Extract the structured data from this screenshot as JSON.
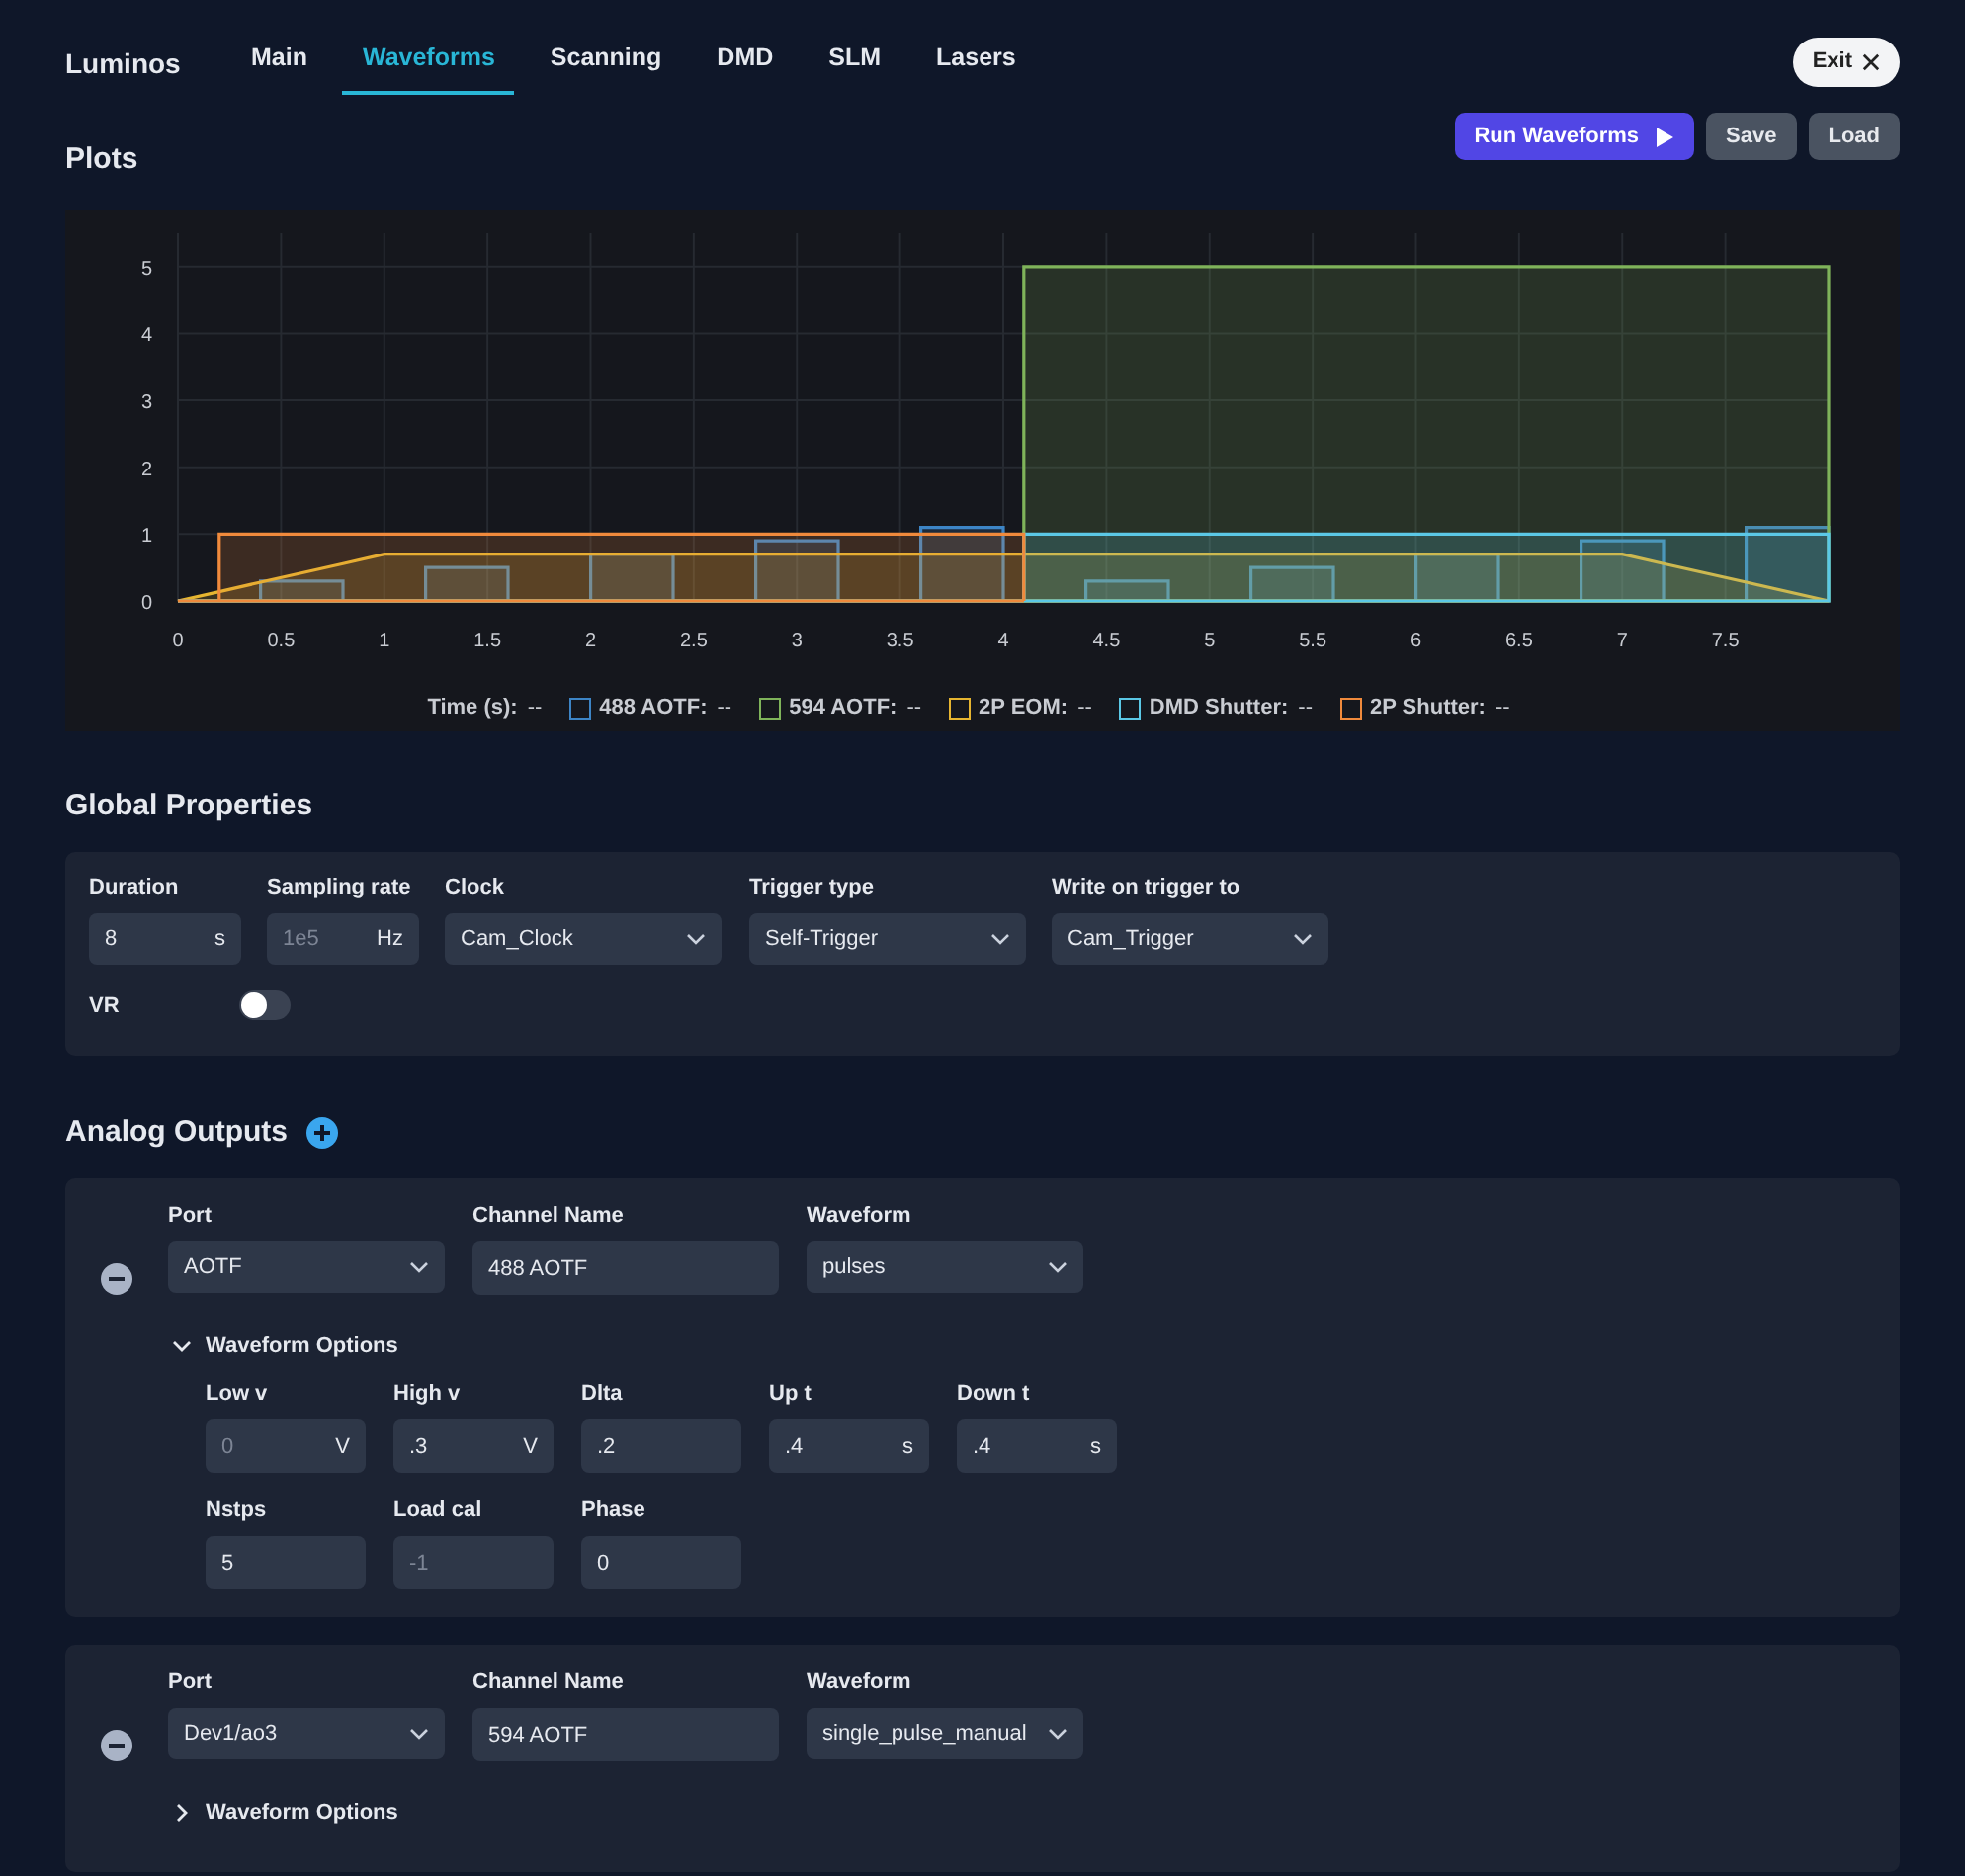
{
  "app": {
    "title": "Luminos"
  },
  "tabs": [
    {
      "label": "Main",
      "selected": false
    },
    {
      "label": "Waveforms",
      "selected": true
    },
    {
      "label": "Scanning",
      "selected": false
    },
    {
      "label": "DMD",
      "selected": false
    },
    {
      "label": "SLM",
      "selected": false
    },
    {
      "label": "Lasers",
      "selected": false
    }
  ],
  "exit_button": {
    "label": "Exit"
  },
  "plots": {
    "title": "Plots",
    "actions": [
      {
        "label": "Run Waveforms",
        "kind": "primary"
      },
      {
        "label": "Save",
        "kind": "secondary"
      },
      {
        "label": "Load",
        "kind": "secondary"
      }
    ],
    "chart_data": {
      "type": "area",
      "grid": true,
      "xlim": [
        0,
        8
      ],
      "ylim": [
        0,
        5.5
      ],
      "xticks": [
        0,
        0.5,
        1,
        1.5,
        2,
        2.5,
        3,
        3.5,
        4,
        4.5,
        5,
        5.5,
        6,
        6.5,
        7,
        7.5
      ],
      "yticks": [
        0,
        1,
        2,
        3,
        4,
        5
      ],
      "x": [
        0,
        0.2,
        0.2,
        0.4,
        0.4,
        0.8,
        0.8,
        1,
        1.2,
        1.2,
        1.6,
        1.6,
        2,
        2,
        2.4,
        2.4,
        2.8,
        2.8,
        3.2,
        3.2,
        3.6,
        3.6,
        4,
        4,
        4.1,
        4.1,
        4.4,
        4.4,
        4.8,
        4.8,
        5.2,
        5.2,
        5.6,
        5.6,
        6,
        6,
        6.4,
        6.4,
        6.8,
        6.8,
        7,
        7.2,
        7.2,
        7.6,
        7.6,
        8,
        8
      ],
      "series": [
        {
          "name": "488 AOTF",
          "color": "#3d85c6",
          "values": [
            0,
            0,
            0,
            0,
            0.3,
            0.3,
            0,
            0,
            0,
            0.5,
            0.5,
            0,
            0,
            0.7,
            0.7,
            0,
            0,
            0.9,
            0.9,
            0,
            0,
            1.1,
            1.1,
            0,
            0,
            0,
            0,
            0.3,
            0.3,
            0,
            0,
            0.5,
            0.5,
            0,
            0,
            0.7,
            0.7,
            0,
            0,
            0.9,
            0.9,
            0.9,
            0,
            0,
            1.1,
            1.1,
            0
          ]
        },
        {
          "name": "594 AOTF",
          "color": "#7fb35a",
          "values": [
            0,
            0,
            0,
            0,
            0,
            0,
            0,
            0,
            0,
            0,
            0,
            0,
            0,
            0,
            0,
            0,
            0,
            0,
            0,
            0,
            0,
            0,
            0,
            0,
            0,
            5,
            5,
            5,
            5,
            5,
            5,
            5,
            5,
            5,
            5,
            5,
            5,
            5,
            5,
            5,
            5,
            5,
            5,
            5,
            5,
            5,
            5
          ]
        },
        {
          "name": "2P EOM",
          "color": "#e6b530",
          "values": [
            0,
            0.14,
            0.14,
            0.28,
            0.28,
            0.56,
            0.56,
            0.7,
            0.7,
            0.7,
            0.7,
            0.7,
            0.7,
            0.7,
            0.7,
            0.7,
            0.7,
            0.7,
            0.7,
            0.7,
            0.7,
            0.7,
            0.7,
            0.7,
            0.7,
            0.7,
            0.7,
            0.7,
            0.7,
            0.7,
            0.7,
            0.7,
            0.7,
            0.7,
            0.7,
            0.7,
            0.7,
            0.7,
            0.7,
            0.7,
            0.7,
            0.56,
            0.56,
            0.28,
            0.28,
            0,
            0
          ]
        },
        {
          "name": "DMD Shutter",
          "color": "#5bc8e6",
          "values": [
            0,
            0,
            0,
            0,
            0,
            0,
            0,
            0,
            0,
            0,
            0,
            0,
            0,
            0,
            0,
            0,
            0,
            0,
            0,
            0,
            0,
            0,
            0,
            0,
            0,
            1,
            1,
            1,
            1,
            1,
            1,
            1,
            1,
            1,
            1,
            1,
            1,
            1,
            1,
            1,
            1,
            1,
            1,
            1,
            1,
            1,
            0
          ]
        },
        {
          "name": "2P Shutter",
          "color": "#f08a3c",
          "values": [
            0,
            0,
            1,
            1,
            1,
            1,
            1,
            1,
            1,
            1,
            1,
            1,
            1,
            1,
            1,
            1,
            1,
            1,
            1,
            1,
            1,
            1,
            1,
            1,
            1,
            0,
            null,
            null,
            null,
            null,
            null,
            null,
            null,
            null,
            null,
            null,
            null,
            null,
            null,
            null,
            null,
            null,
            null,
            null,
            null,
            null,
            null
          ]
        }
      ]
    },
    "legend": {
      "time_label": "Time (s):",
      "time_value": "--",
      "separator": ":",
      "readings": [
        "--",
        "--",
        "--",
        "--",
        "--"
      ]
    }
  },
  "global_properties": {
    "title": "Global Properties",
    "fields": [
      {
        "label": "Duration",
        "kind": "number",
        "value": "8",
        "unit": "s"
      },
      {
        "label": "Sampling rate",
        "kind": "number",
        "placeholder": "1e5",
        "unit": "Hz"
      },
      {
        "label": "Clock",
        "kind": "select",
        "value": "Cam_Clock"
      },
      {
        "label": "Trigger type",
        "kind": "select",
        "value": "Self-Trigger"
      },
      {
        "label": "Write on trigger to",
        "kind": "select",
        "value": "Cam_Trigger"
      }
    ],
    "toggle": {
      "label": "VR",
      "on": false
    }
  },
  "analog_outputs": {
    "title": "Analog Outputs",
    "channels": [
      {
        "port": {
          "label": "Port",
          "value": "AOTF"
        },
        "channel_name": {
          "label": "Channel Name",
          "value": "488 AOTF"
        },
        "waveform": {
          "label": "Waveform",
          "value": "pulses"
        },
        "options": {
          "label": "Waveform Options",
          "expanded": true,
          "fields": [
            {
              "label": "Low v",
              "placeholder": "0",
              "unit": "V"
            },
            {
              "label": "High v",
              "value": ".3",
              "unit": "V"
            },
            {
              "label": "Dlta",
              "value": ".2"
            },
            {
              "label": "Up t",
              "value": ".4",
              "unit": "s"
            },
            {
              "label": "Down t",
              "value": ".4",
              "unit": "s"
            },
            {
              "label": "Nstps",
              "value": "5"
            },
            {
              "label": "Load cal",
              "placeholder": "-1"
            },
            {
              "label": "Phase",
              "value": "0"
            }
          ]
        }
      },
      {
        "port": {
          "label": "Port",
          "value": "Dev1/ao3"
        },
        "channel_name": {
          "label": "Channel Name",
          "value": "594 AOTF"
        },
        "waveform": {
          "label": "Waveform",
          "value": "single_pulse_manual"
        },
        "options": {
          "label": "Waveform Options",
          "expanded": false
        }
      }
    ]
  }
}
